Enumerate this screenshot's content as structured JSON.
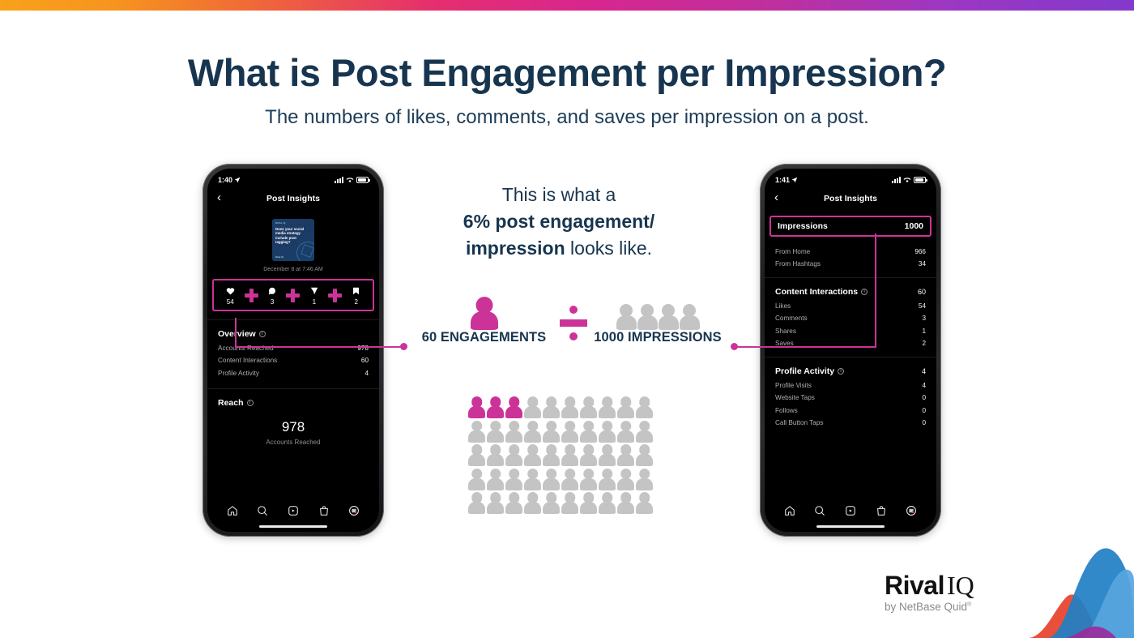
{
  "page": {
    "title": "What is Post Engagement per Impression?",
    "subtitle": "The numbers of likes, comments, and saves per impression on a post."
  },
  "colors": {
    "title_navy": "#17354f",
    "accent_pink": "#cc3399",
    "people_gray": "#c4c4c4",
    "gradient_start": "#f9a11b",
    "gradient_mid": "#d8268f",
    "gradient_end": "#8239cc"
  },
  "center_copy": {
    "line1": "This is what a",
    "line2": "6% post engagement/",
    "line3_bold": "impression",
    "line3_rest": " looks like."
  },
  "equation": {
    "left_label": "60 ENGAGEMENTS",
    "operator": "divide-icon",
    "right_label": "1000 IMPRESSIONS",
    "left_icon_count": 1,
    "right_icon_count": 4
  },
  "people_grid": {
    "columns": 10,
    "rows": 5,
    "total": 50,
    "highlighted": 3,
    "highlight_color": "#cc3399",
    "base_color": "#c4c4c4"
  },
  "left_phone": {
    "status": {
      "time": "1:40",
      "location_icon": "location-arrow-icon",
      "signal": "signal-bars-icon",
      "wifi": "wifi-icon",
      "battery": "battery-icon"
    },
    "nav": {
      "back": "‹",
      "title": "Post Insights"
    },
    "post": {
      "thumb_eyebrow": "RIVAL IQ",
      "thumb_title": "Does your social media strategy include post tagging?",
      "thumb_logo": "Rival IQ",
      "date": "December 8 at 7:46 AM"
    },
    "metrics": [
      {
        "icon": "heart-icon",
        "value": "54"
      },
      {
        "icon": "comment-icon",
        "value": "3"
      },
      {
        "icon": "share-icon",
        "value": "1"
      },
      {
        "icon": "bookmark-icon",
        "value": "2"
      }
    ],
    "overview": {
      "heading": "Overview",
      "rows": [
        {
          "label": "Accounts Reached",
          "value": "978"
        },
        {
          "label": "Content Interactions",
          "value": "60"
        },
        {
          "label": "Profile Activity",
          "value": "4"
        }
      ]
    },
    "reach": {
      "heading": "Reach",
      "number": "978",
      "caption": "Accounts Reached"
    },
    "tabs": [
      "home-icon",
      "search-icon",
      "reels-icon",
      "shop-icon",
      "profile-avatar-icon"
    ]
  },
  "right_phone": {
    "status": {
      "time": "1:41",
      "location_icon": "location-arrow-icon",
      "signal": "signal-bars-icon",
      "wifi": "wifi-icon",
      "battery": "battery-icon"
    },
    "nav": {
      "back": "‹",
      "title": "Post Insights"
    },
    "impressions": {
      "label": "Impressions",
      "value": "1000"
    },
    "impression_rows": [
      {
        "label": "From Home",
        "value": "966"
      },
      {
        "label": "From Hashtags",
        "value": "34"
      }
    ],
    "content_interactions": {
      "heading": "Content Interactions",
      "total": "60",
      "rows": [
        {
          "label": "Likes",
          "value": "54"
        },
        {
          "label": "Comments",
          "value": "3"
        },
        {
          "label": "Shares",
          "value": "1"
        },
        {
          "label": "Saves",
          "value": "2"
        }
      ]
    },
    "profile_activity": {
      "heading": "Profile Activity",
      "total": "4",
      "rows": [
        {
          "label": "Profile Visits",
          "value": "4"
        },
        {
          "label": "Website Taps",
          "value": "0"
        },
        {
          "label": "Follows",
          "value": "0"
        },
        {
          "label": "Call Button Taps",
          "value": "0"
        }
      ]
    },
    "tabs": [
      "home-icon",
      "search-icon",
      "reels-icon",
      "shop-icon",
      "profile-avatar-icon"
    ]
  },
  "logo": {
    "brand_bold": "Rival",
    "brand_serif": "IQ",
    "tagline": "by NetBase Quid",
    "tagline_mark": "®"
  }
}
